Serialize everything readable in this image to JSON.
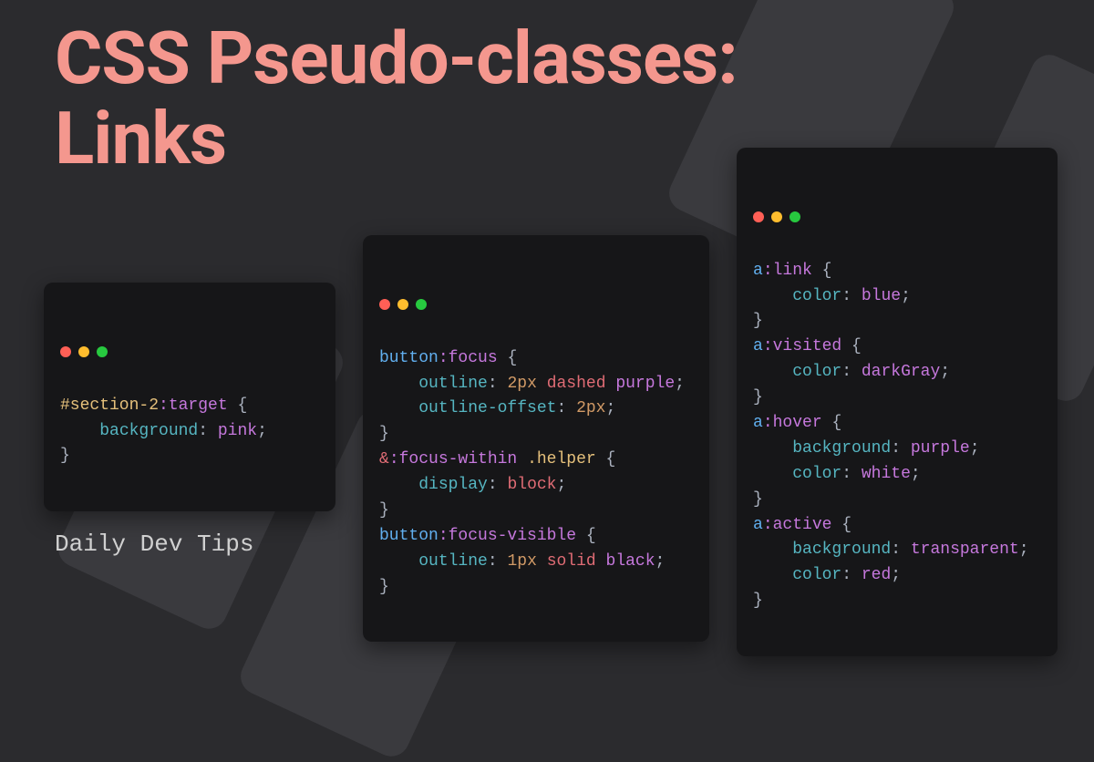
{
  "title_line1": "CSS Pseudo-classes:",
  "title_line2": "Links",
  "footer": "Daily Dev Tips",
  "c1": {
    "sel_id": "#section-2",
    "sel_pse": ":target",
    "prop": "background",
    "val": "pink"
  },
  "c2": {
    "r1_sel": "button",
    "r1_pse": ":focus",
    "r1_p1": "outline",
    "r1_v1a": "2px",
    "r1_v1b": "dashed",
    "r1_v1c": "purple",
    "r1_p2": "outline-offset",
    "r1_v2": "2px",
    "r2_op": "&",
    "r2_pse": ":focus-within",
    "r2_cls": ".helper",
    "r2_p1": "display",
    "r2_v1": "block",
    "r3_sel": "button",
    "r3_pse": ":focus-visible",
    "r3_p1": "outline",
    "r3_v1a": "1px",
    "r3_v1b": "solid",
    "r3_v1c": "black"
  },
  "c3": {
    "r1_sel": "a",
    "r1_pse": ":link",
    "r1_p": "color",
    "r1_v": "blue",
    "r2_sel": "a",
    "r2_pse": ":visited",
    "r2_p": "color",
    "r2_v": "darkGray",
    "r3_sel": "a",
    "r3_pse": ":hover",
    "r3_p1": "background",
    "r3_v1": "purple",
    "r3_p2": "color",
    "r3_v2": "white",
    "r4_sel": "a",
    "r4_pse": ":active",
    "r4_p1": "background",
    "r4_v1": "transparent",
    "r4_p2": "color",
    "r4_v2": "red"
  }
}
